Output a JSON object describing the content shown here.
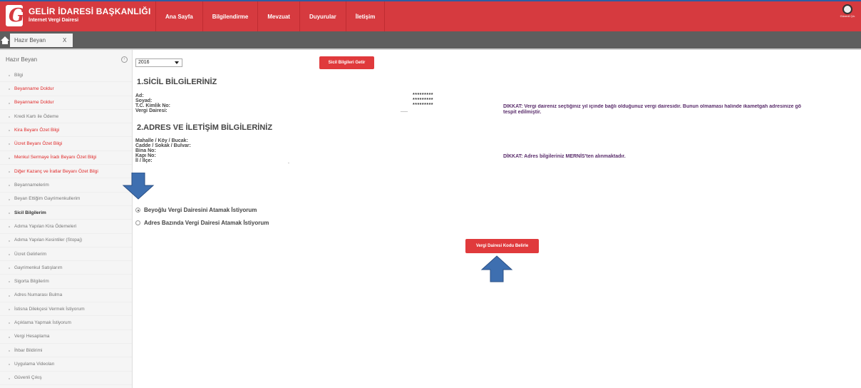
{
  "header": {
    "logo_letter": "G",
    "title": "GELİR İDARESİ BAŞKANLIĞI",
    "subtitle": "İnternet Vergi Dairesi",
    "nav": [
      "Ana Sayfa",
      "Bilgilendirme",
      "Mevzuat",
      "Duyurular",
      "İletişim"
    ],
    "user_label": "Güvenli Çık"
  },
  "tabbar": {
    "tab_label": "Hazır Beyan",
    "tab_close": "X"
  },
  "sidebar": {
    "heading": "Hazır Beyan",
    "collapse_glyph": "‹",
    "items": [
      {
        "label": "Bilgi",
        "style": "normal"
      },
      {
        "label": "Beyanname Doldur",
        "style": "red"
      },
      {
        "label": "Beyanname Doldur",
        "style": "red"
      },
      {
        "label": "Kredi Kartı ile Ödeme",
        "style": "normal"
      },
      {
        "label": "Kira Beyanı Özet Bilgi",
        "style": "red"
      },
      {
        "label": "Ücret Beyanı Özet Bilgi",
        "style": "red"
      },
      {
        "label": "Menkul Sermaye İradı Beyanı Özet Bilgi",
        "style": "red"
      },
      {
        "label": "Diğer Kazanç ve İratlar Beyanı Özet Bilgi",
        "style": "red"
      },
      {
        "label": "Beyannamelerim",
        "style": "normal"
      },
      {
        "label": "Beyan Ettiğim Gayrimenkullerim",
        "style": "normal"
      },
      {
        "label": "Sicil Bilgilerim",
        "style": "active"
      },
      {
        "label": "Adıma Yapılan Kira Ödemeleri",
        "style": "normal"
      },
      {
        "label": "Adıma Yapılan Kesintiler (Stopaj)",
        "style": "normal"
      },
      {
        "label": "Ücret Gelirlerim",
        "style": "normal"
      },
      {
        "label": "Gayrimenkul Satışlarım",
        "style": "normal"
      },
      {
        "label": "Sigorta Bilgilerim",
        "style": "normal"
      },
      {
        "label": "Adres Numarası Bulma",
        "style": "normal"
      },
      {
        "label": "İstisna Dilekçesi Vermek İstiyorum",
        "style": "normal"
      },
      {
        "label": "Açıklama Yapmak İstiyorum",
        "style": "normal"
      },
      {
        "label": "Vergi Hesaplama",
        "style": "normal"
      },
      {
        "label": "İhbar Bildirimi",
        "style": "normal"
      },
      {
        "label": "Uygulama Videoları",
        "style": "normal"
      },
      {
        "label": "Güvenli Çıkış",
        "style": "normal"
      }
    ]
  },
  "main": {
    "year_value": "2016",
    "fetch_button": "Sicil Bilgileri Getir",
    "section1_title": "1.SİCİL BİLGİLERİNİZ",
    "registry": {
      "name_label": "Ad:",
      "surname_label": "Soyad:",
      "tckn_label": "T.C. Kimlik No:",
      "office_label": "Vergi Dairesi:",
      "name_value": "*********",
      "surname_value": "*********",
      "tckn_value": "*********",
      "office_value": "___"
    },
    "note1_line1": "DİKKAT: Vergi daireniz seçtiğiniz yıl içinde bağlı olduğunuz vergi dairesidir. Bunun olmaması halinde ikametgah adresinize gö",
    "note1_line2": "tespit edilmiştir.",
    "section2_title": "2.ADRES VE İLETİŞİM BİLGİLERİNİZ",
    "address": {
      "mahalle_label": "Mahalle / Köy / Bucak:",
      "cadde_label": "Cadde / Sokak / Bulvar:",
      "bina_label": "Bina No:",
      "kapi_label": "Kapı No:",
      "il_label": "İl / İlçe:",
      "il_value": "-"
    },
    "note2": "DİKKAT: Adres bilgileriniz MERNİS'ten alınmaktadır.",
    "radio1": "Beyoğlu Vergi Dairesini Atamak İstiyorum",
    "radio2": "Adres Bazında Vergi Dairesi Atamak İstiyorum",
    "assign_button": "Vergi Dairesi Kodu Belirle"
  },
  "colors": {
    "brand_red": "#d63a3f",
    "button_red": "#e03a3c",
    "arrow_blue": "#3e6fb0",
    "note_purple": "#5a2d6b"
  }
}
